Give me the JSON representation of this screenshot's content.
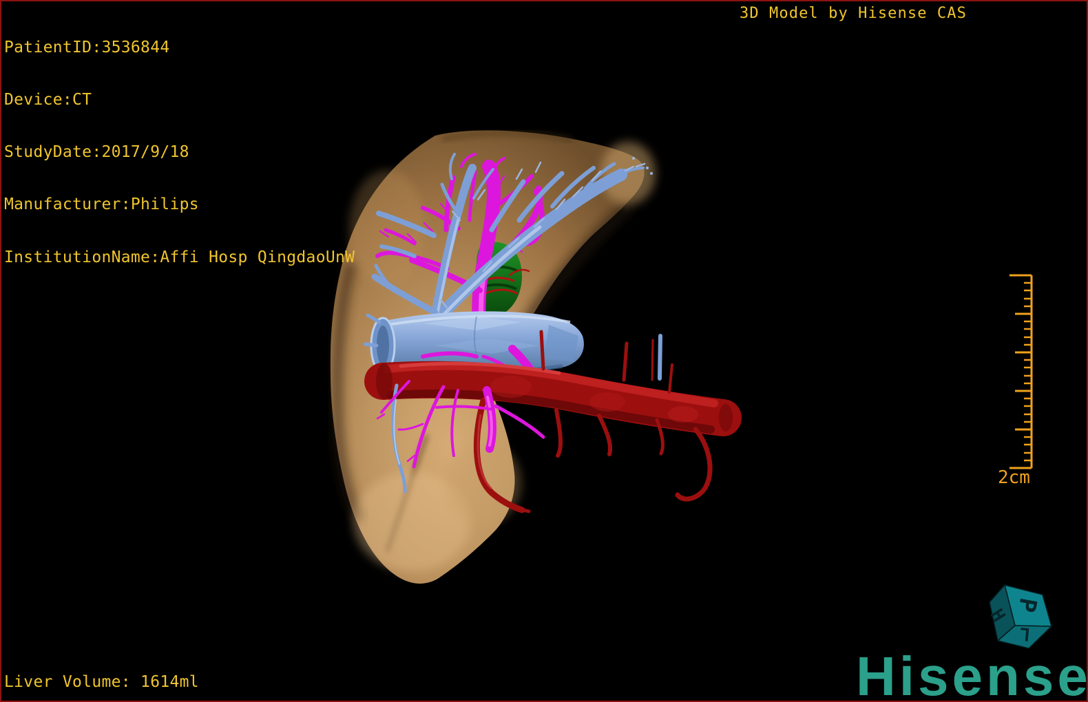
{
  "overlay": {
    "patient": {
      "lines": [
        "PatientID:3536844",
        "Device:CT",
        "StudyDate:2017/9/18",
        "Manufacturer:Philips",
        "InstitutionName:Affi Hosp QingdaoUnW"
      ]
    },
    "title": "3D Model by Hisense CAS",
    "liver_volume": "Liver Volume: 1614ml"
  },
  "scale_bar": {
    "label": "2cm"
  },
  "orientation_cube": {
    "letters": {
      "top": "P",
      "left": "H",
      "front": "L"
    }
  },
  "branding": {
    "logo_text": "Hisense"
  },
  "model": {
    "structures": [
      "liver",
      "hepatic veins",
      "portal vessels",
      "artery trunk",
      "bile structure"
    ]
  },
  "colors": {
    "overlay_text": "#f0c52f",
    "scale_bar": "#f0a21c",
    "logo_teal": "#2ba08b",
    "liver_tan": "#b08753",
    "hepatic_vein_blue": "#7d9fd6",
    "portal_vein_magenta": "#dd16dd",
    "artery_dark_red": "#9c0f0f",
    "bile_green": "#157a1a",
    "border_red": "#8d1212",
    "cube_face_top": "#0e858e",
    "cube_face_left": "#0a525a",
    "cube_face_front": "#0c6f77"
  }
}
